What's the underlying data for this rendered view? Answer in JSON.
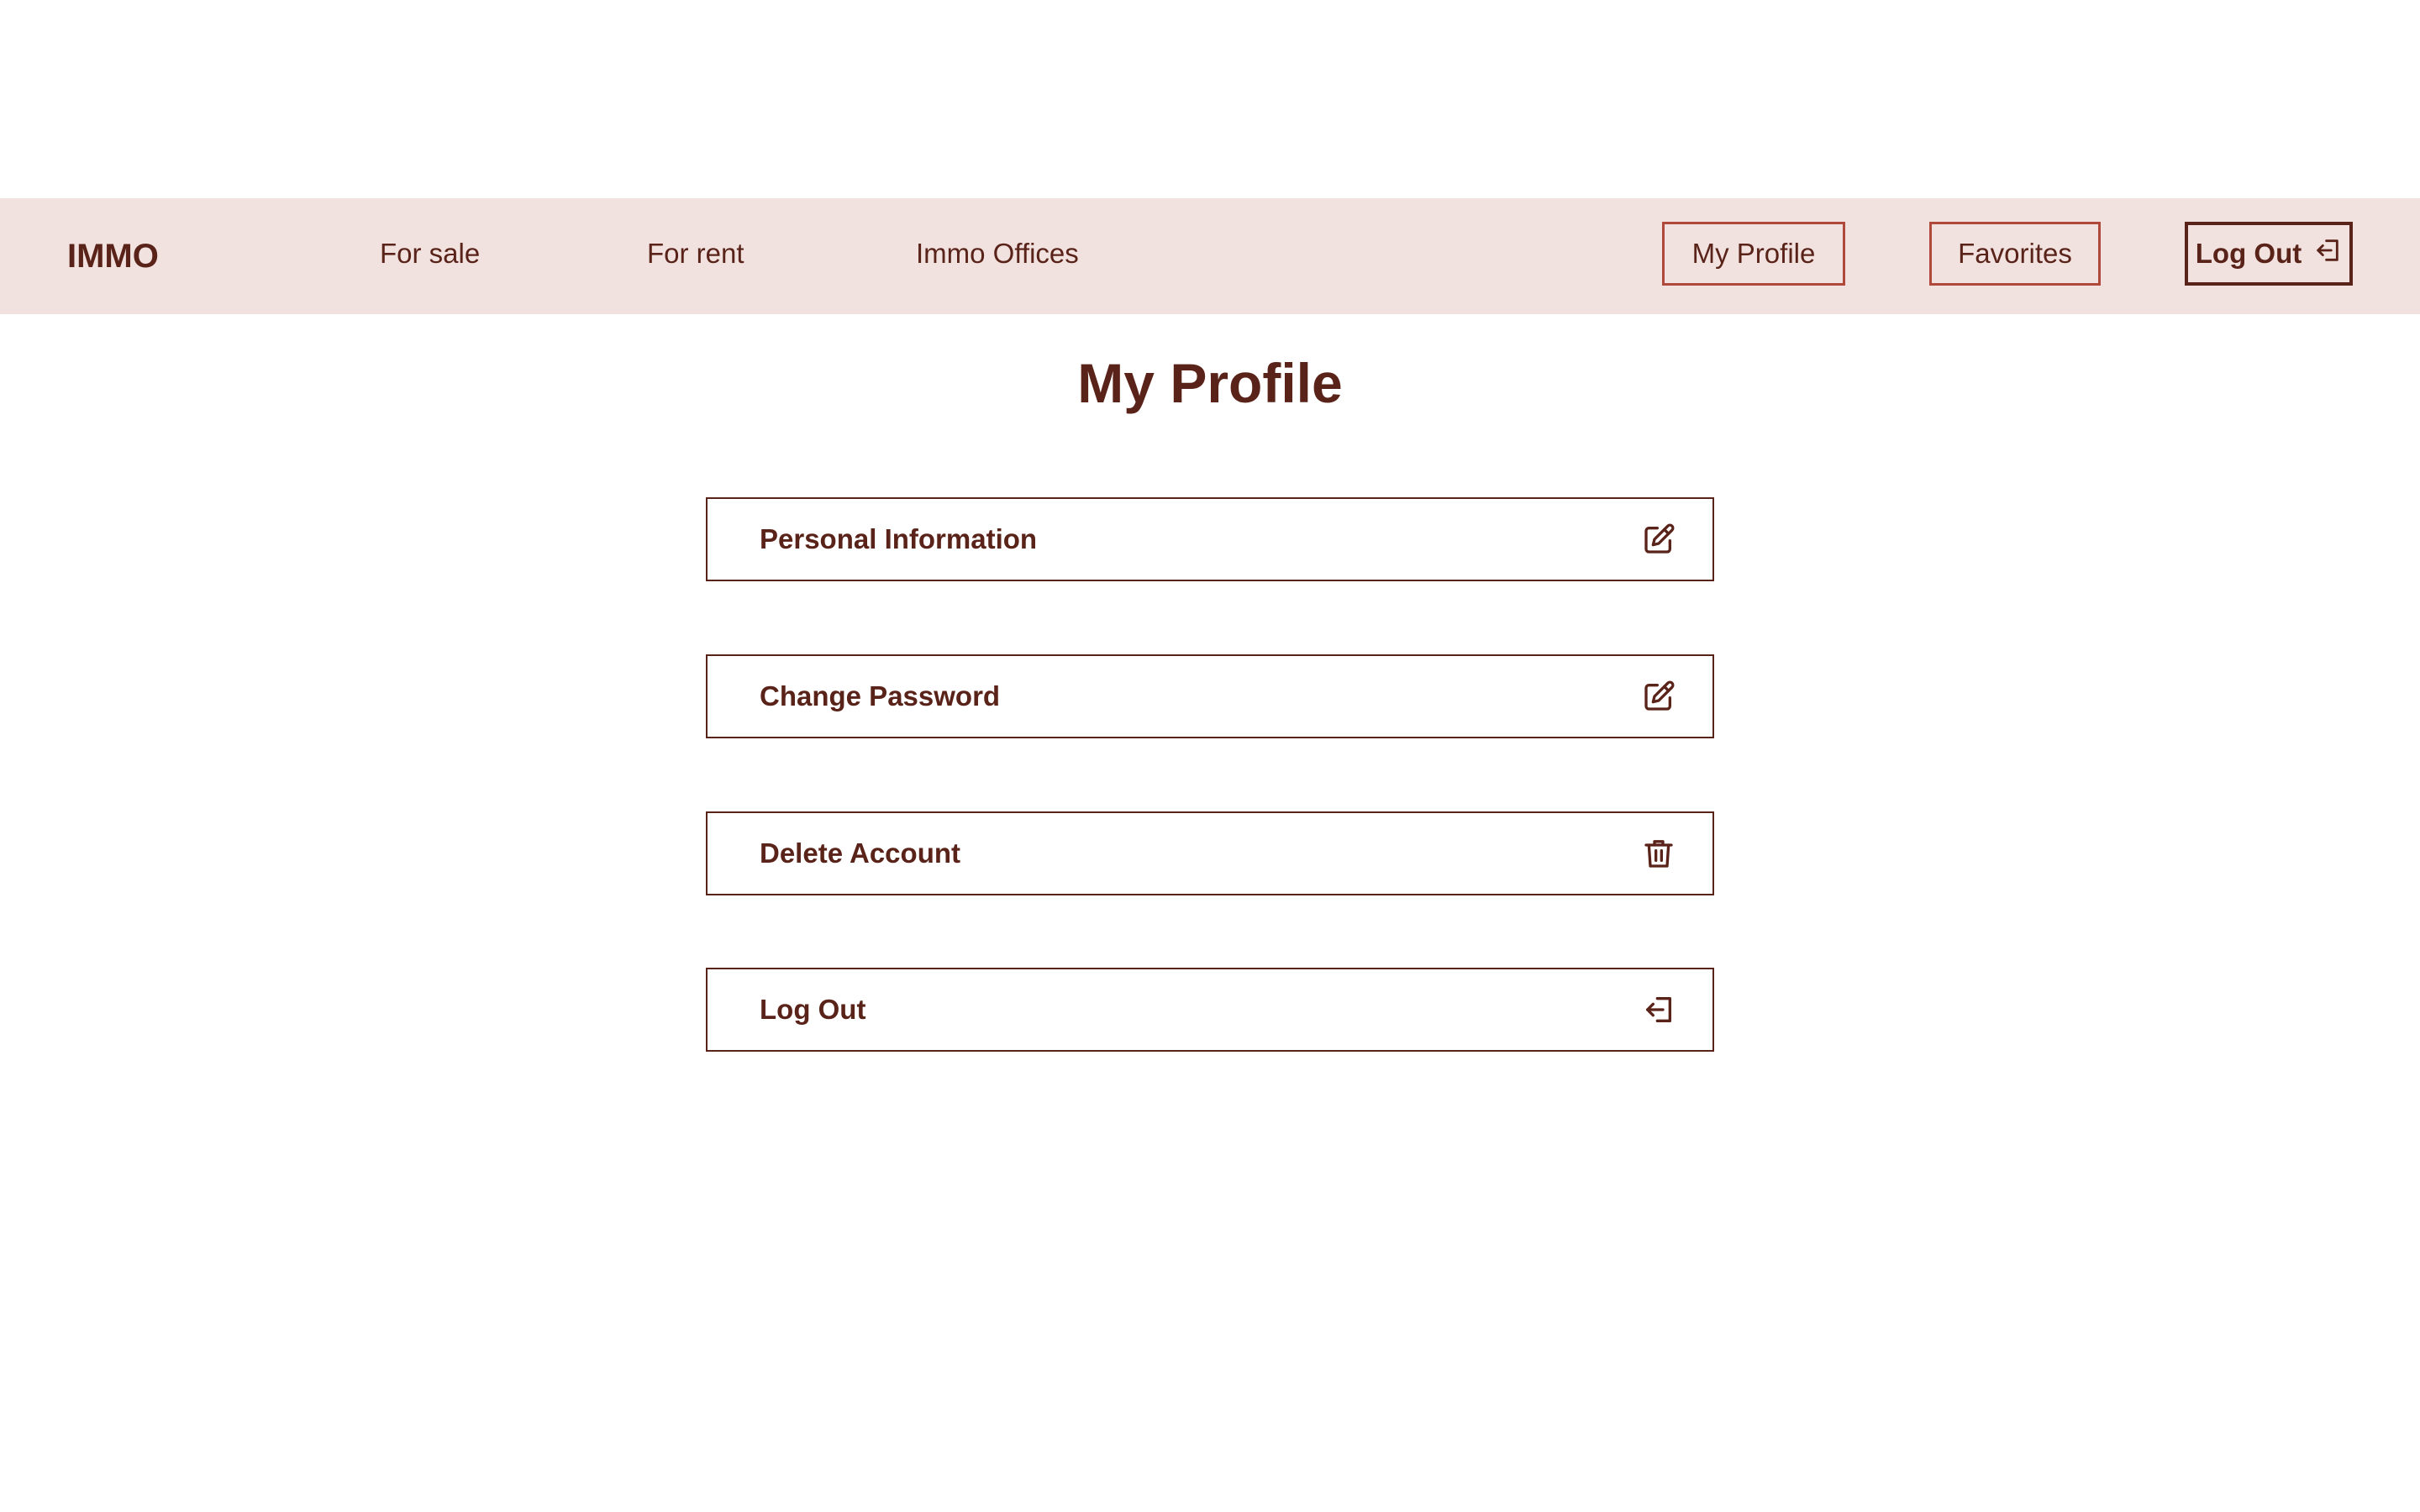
{
  "nav": {
    "brand": "IMMO",
    "links": [
      "For sale",
      "For rent",
      "Immo Offices"
    ],
    "my_profile_label": "My Profile",
    "favorites_label": "Favorites",
    "logout_label": "Log Out",
    "logout_icon": "logout-icon"
  },
  "page": {
    "title": "My Profile"
  },
  "options": [
    {
      "label": "Personal Information",
      "icon": "edit-icon"
    },
    {
      "label": "Change Password",
      "icon": "edit-icon"
    },
    {
      "label": "Delete Account",
      "icon": "trash-icon"
    },
    {
      "label": "Log Out",
      "icon": "logout-icon"
    }
  ],
  "colors": {
    "primary": "#5a2319",
    "accent_border": "#b0483b",
    "nav_background": "#f1e2df",
    "background": "#ffffff"
  }
}
